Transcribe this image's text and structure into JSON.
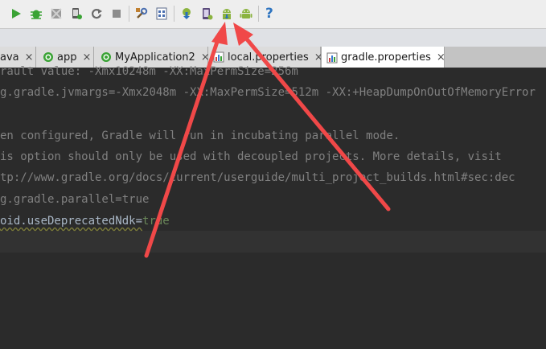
{
  "tabs": [
    {
      "label": "ava",
      "active": false
    },
    {
      "label": "app",
      "active": false
    },
    {
      "label": "MyApplication2",
      "active": false
    },
    {
      "label": "local.properties",
      "active": false
    },
    {
      "label": "gradle.properties",
      "active": true
    }
  ],
  "tab_close_glyph": "×",
  "toolbar": {
    "icons": [
      "run-icon",
      "debug-icon",
      "attach-debugger-icon",
      "android-device-monitor-icon",
      "rerun-icon",
      "stop-icon",
      "project-structure-icon",
      "sdk-manager-icon",
      "sync-project-icon",
      "avd-manager-icon",
      "android-download-icon",
      "android-icon",
      "help-icon"
    ],
    "help_glyph": "?"
  },
  "editor": {
    "lines": [
      {
        "text": "rault value: -Xmx10248m -XX:MaxPermSize=256m",
        "kind": "comment"
      },
      {
        "key": "g.gradle.jvmargs=",
        "value": "-Xmx2048m -XX:MaxPermSize=512m -XX:+HeapDumpOnOutOfMemoryError"
      },
      {
        "text": "",
        "kind": "blank"
      },
      {
        "text": "en configured, Gradle will run in incubating parallel mode.",
        "kind": "comment"
      },
      {
        "text": "is option should only be used with decoupled projects. More details, visit",
        "kind": "comment"
      },
      {
        "text": "tp://www.gradle.org/docs/current/userguide/multi_project_builds.html#sec:dec",
        "kind": "comment"
      },
      {
        "key": "g.gradle.parallel=",
        "value": "true"
      },
      {
        "key": "oid.useDeprecatedNdk=",
        "value": "true"
      }
    ]
  },
  "colors": {
    "editor_bg": "#2b2b2b",
    "comment": "#808080",
    "text": "#a9b7c6",
    "value": "#6a8759",
    "annotation_arrow": "#f04848",
    "android_green": "#8bb33f",
    "run_green": "#3aa335"
  }
}
